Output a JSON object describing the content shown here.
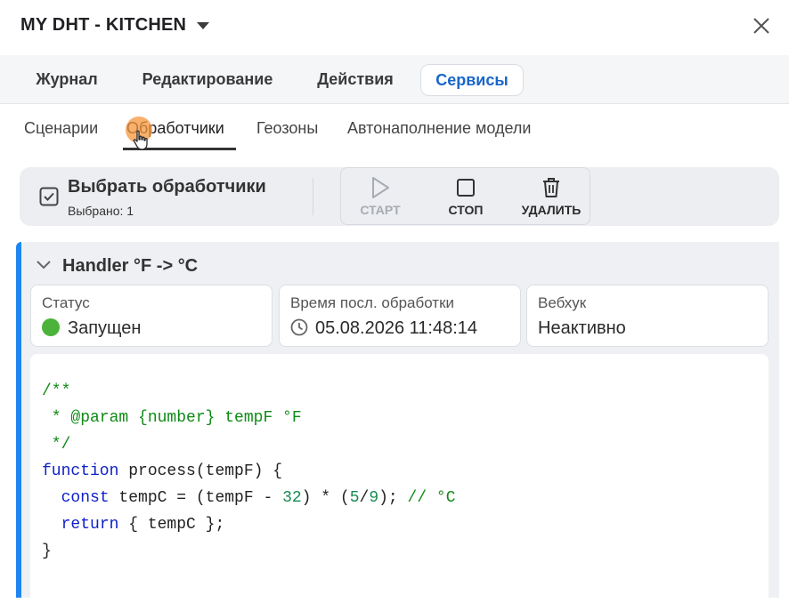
{
  "header": {
    "device_title": "MY DHT - KITCHEN"
  },
  "main_tabs": [
    {
      "label": "Журнал",
      "active": false
    },
    {
      "label": "Редактирование",
      "active": false
    },
    {
      "label": "Действия",
      "active": false
    },
    {
      "label": "Сервисы",
      "active": true
    }
  ],
  "sub_tabs": [
    {
      "label": "Сценарии",
      "active": false
    },
    {
      "label": "Обработчики",
      "active": true
    },
    {
      "label": "Геозоны",
      "active": false
    },
    {
      "label": "Автонаполнение модели",
      "active": false
    }
  ],
  "toolbar": {
    "select_title": "Выбрать обработчики",
    "selected_count": "Выбрано: 1",
    "start_label": "СТАРТ",
    "stop_label": "СТОП",
    "delete_label": "УДАЛИТЬ"
  },
  "handler": {
    "title": "Handler °F -> °C",
    "status_label": "Статус",
    "status_value": "Запущен",
    "last_run_label": "Время посл. обработки",
    "last_run_value": "05.08.2026 11:48:14",
    "webhook_label": "Вебхук",
    "webhook_value": "Неактивно",
    "code": {
      "line1": "/**",
      "line2": " * @param {number} tempF °F",
      "line3": " */",
      "line4_kw": "function",
      "line4_rest": " process(tempF) {",
      "line5_kw": "const",
      "line5_a": " tempC = (tempF - ",
      "line5_num1": "32",
      "line5_b": ") * (",
      "line5_num2": "5",
      "line5_c": "/",
      "line5_num3": "9",
      "line5_d": "); ",
      "line5_com": "// °C",
      "line6_kw": "return",
      "line6_rest": " { tempC };",
      "line7": "}"
    }
  },
  "colors": {
    "accent_blue": "#1f86f0",
    "active_tab_text": "#1a66c9",
    "status_green": "#4cb33a",
    "code_comment": "#0f8a16",
    "code_keyword": "#1020c8",
    "code_number": "#178a52"
  },
  "icons": {
    "title_dropdown": "caret-down-icon",
    "close": "close-icon",
    "select": "checkbox-checked-icon",
    "start": "play-icon",
    "stop": "stop-icon",
    "delete": "trash-icon",
    "collapse": "chevron-down-icon",
    "last_run": "clock-icon"
  }
}
